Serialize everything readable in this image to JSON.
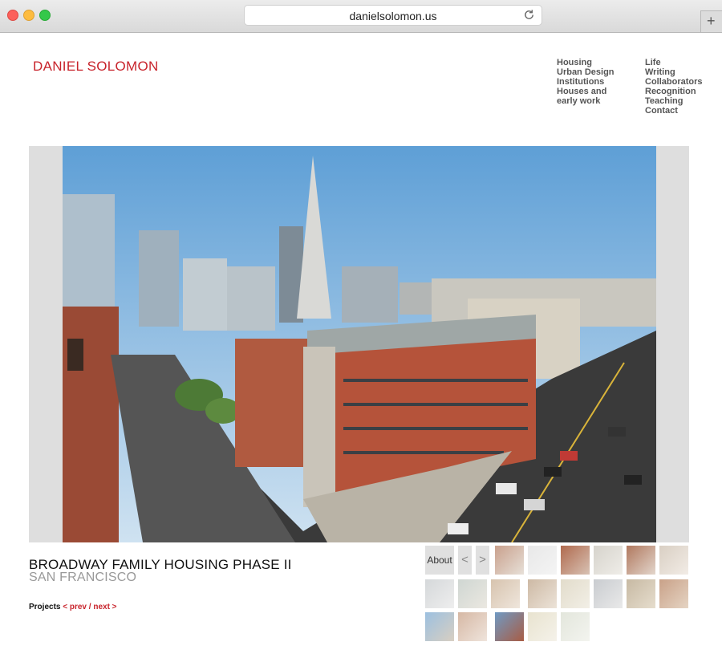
{
  "browser": {
    "url": "danielsolomon.us"
  },
  "site": {
    "logo": "DANIEL SOLOMON"
  },
  "nav": {
    "col1": [
      "Housing",
      "Urban Design",
      "Institutions",
      "Houses and early work"
    ],
    "col2": [
      "Life",
      "Writing",
      "Collaborators",
      "Recognition",
      "Teaching",
      "Contact"
    ]
  },
  "project": {
    "title": "BROADWAY FAMILY HOUSING PHASE II",
    "location": "SAN FRANCISCO"
  },
  "pager": {
    "projects_label": "Projects",
    "prev_label": "< prev",
    "separator": " / ",
    "next_label": "next >"
  },
  "thumbs": {
    "about_label": "About",
    "prev_arrow": "<",
    "next_arrow": ">",
    "count": 17
  },
  "colors": {
    "brand_red": "#c8242c",
    "sky": "#7fb3dd",
    "brick": "#b5533a"
  }
}
